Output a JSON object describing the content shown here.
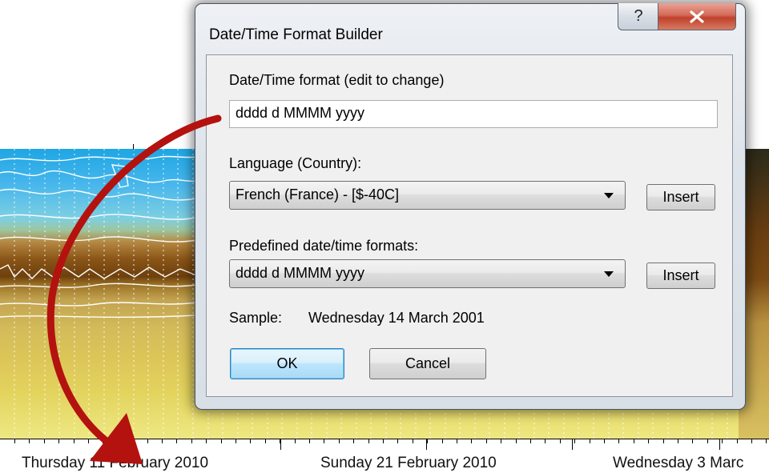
{
  "dialog": {
    "title": "Date/Time Format Builder",
    "help_glyph": "?",
    "format_label": "Date/Time format (edit to change)",
    "format_value": "dddd d MMMM yyyy",
    "language_label": "Language (Country):",
    "language_value": "French (France) - [$-40C]",
    "language_insert": "Insert",
    "predefined_label": "Predefined date/time formats:",
    "predefined_value": "dddd d MMMM yyyy",
    "predefined_insert": "Insert",
    "sample_label": "Sample:",
    "sample_value": "Wednesday 14 March 2001",
    "ok_label": "OK",
    "cancel_label": "Cancel"
  },
  "plot": {
    "axis_labels": [
      "Thursday 11 February 2010",
      "Sunday 21 February 2010",
      "Wednesday 3 Marc"
    ]
  },
  "icons": {
    "close": "close-icon",
    "help": "help-icon",
    "dropdown": "chevron-down-icon",
    "annotation": "curved-arrow-icon"
  },
  "colors": {
    "arrow": "#b3120f",
    "ok_border": "#3c7fb1",
    "close_button": "#c0412c"
  }
}
